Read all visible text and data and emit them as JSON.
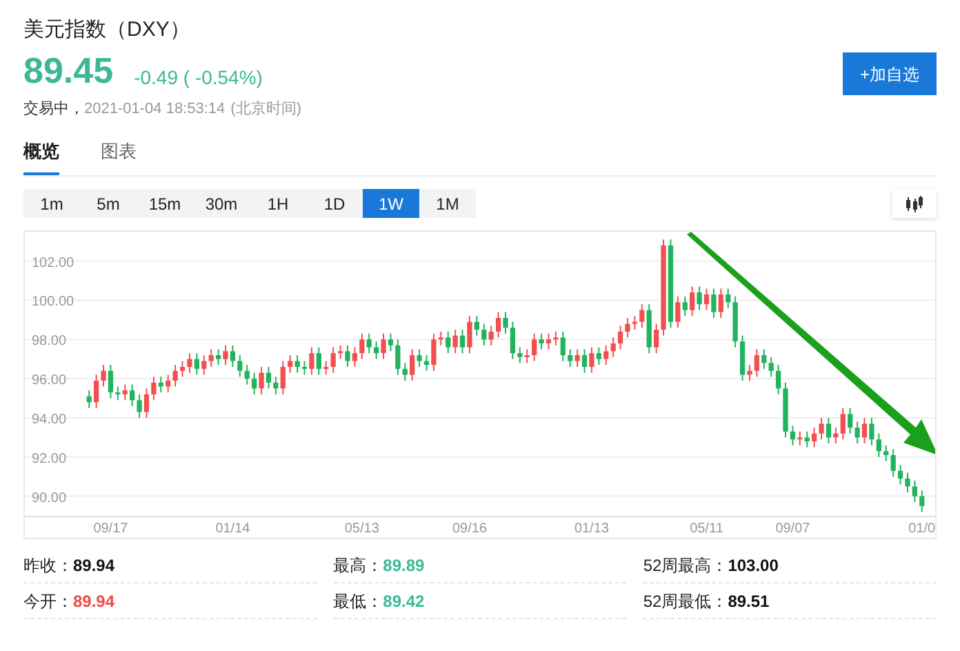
{
  "header": {
    "title": "美元指数（DXY）",
    "price": "89.45",
    "change": "-0.49 ( -0.54%)",
    "color": "#3cb896",
    "status": "交易中，",
    "time": "2021-01-04 18:53:14",
    "timezone": "(北京时间)",
    "watch_button": "+加自选"
  },
  "tabs": [
    {
      "label": "概览",
      "selected": true
    },
    {
      "label": "图表",
      "selected": false
    }
  ],
  "periods": [
    {
      "label": "1m",
      "selected": false
    },
    {
      "label": "5m",
      "selected": false
    },
    {
      "label": "15m",
      "selected": false
    },
    {
      "label": "30m",
      "selected": false
    },
    {
      "label": "1H",
      "selected": false
    },
    {
      "label": "1D",
      "selected": false
    },
    {
      "label": "1W",
      "selected": true
    },
    {
      "label": "1M",
      "selected": false
    }
  ],
  "chart": {
    "chart_data": {
      "type": "candlestick",
      "grid": true,
      "ylim": [
        89,
        103.5
      ],
      "yticks": [
        {
          "value": 90,
          "label": "90.00"
        },
        {
          "value": 92,
          "label": "92.00"
        },
        {
          "value": 94,
          "label": "94.00"
        },
        {
          "value": 96,
          "label": "96.00"
        },
        {
          "value": 98,
          "label": "98.00"
        },
        {
          "value": 100,
          "label": "100.00"
        },
        {
          "value": 102,
          "label": "102.00"
        }
      ],
      "categories": [
        null,
        null,
        null,
        "09/17",
        null,
        null,
        null,
        null,
        null,
        null,
        null,
        null,
        null,
        null,
        null,
        null,
        null,
        null,
        null,
        null,
        "01/14",
        null,
        null,
        null,
        null,
        null,
        null,
        null,
        null,
        null,
        null,
        null,
        null,
        null,
        null,
        null,
        null,
        null,
        "05/13",
        null,
        null,
        null,
        null,
        null,
        null,
        null,
        null,
        null,
        null,
        null,
        null,
        null,
        null,
        "09/16",
        null,
        null,
        null,
        null,
        null,
        null,
        null,
        null,
        null,
        null,
        null,
        null,
        null,
        null,
        null,
        null,
        "01/13",
        null,
        null,
        null,
        null,
        null,
        null,
        null,
        null,
        null,
        null,
        null,
        null,
        null,
        null,
        null,
        "05/11",
        null,
        null,
        null,
        null,
        null,
        null,
        null,
        null,
        null,
        null,
        null,
        "09/07",
        null,
        null,
        null,
        null,
        null,
        null,
        null,
        null,
        null,
        null,
        null,
        null,
        null,
        null,
        null,
        null,
        null,
        "01/0"
      ],
      "ohlc": [
        [
          95.1,
          95.4,
          94.5,
          94.8
        ],
        [
          94.8,
          96.2,
          94.5,
          95.9
        ],
        [
          95.9,
          96.7,
          95.6,
          96.4
        ],
        [
          96.4,
          96.7,
          95.0,
          95.3
        ],
        [
          95.3,
          95.6,
          94.9,
          95.2
        ],
        [
          95.2,
          95.7,
          94.9,
          95.4
        ],
        [
          95.4,
          95.7,
          94.6,
          94.9
        ],
        [
          94.9,
          95.2,
          94.0,
          94.3
        ],
        [
          94.3,
          95.5,
          94.0,
          95.2
        ],
        [
          95.2,
          96.1,
          94.9,
          95.8
        ],
        [
          95.8,
          96.1,
          95.3,
          95.6
        ],
        [
          95.6,
          96.2,
          95.3,
          95.9
        ],
        [
          95.9,
          96.7,
          95.6,
          96.4
        ],
        [
          96.4,
          96.9,
          96.1,
          96.6
        ],
        [
          96.6,
          97.3,
          96.3,
          97.0
        ],
        [
          97.0,
          97.3,
          96.2,
          96.5
        ],
        [
          96.5,
          97.2,
          96.2,
          96.9
        ],
        [
          96.9,
          97.5,
          96.6,
          97.2
        ],
        [
          97.2,
          97.5,
          96.7,
          97.0
        ],
        [
          97.0,
          97.7,
          96.7,
          97.4
        ],
        [
          97.4,
          97.7,
          96.6,
          96.9
        ],
        [
          96.9,
          97.2,
          96.1,
          96.4
        ],
        [
          96.4,
          96.7,
          95.7,
          96.0
        ],
        [
          96.0,
          96.3,
          95.2,
          95.5
        ],
        [
          95.5,
          96.6,
          95.2,
          96.3
        ],
        [
          96.3,
          96.6,
          95.5,
          95.8
        ],
        [
          95.8,
          96.1,
          95.2,
          95.5
        ],
        [
          95.5,
          96.9,
          95.2,
          96.6
        ],
        [
          96.6,
          97.2,
          96.3,
          96.9
        ],
        [
          96.9,
          97.2,
          96.3,
          96.6
        ],
        [
          96.6,
          96.9,
          96.2,
          96.5
        ],
        [
          96.5,
          97.6,
          96.2,
          97.3
        ],
        [
          97.3,
          97.6,
          96.2,
          96.5
        ],
        [
          96.5,
          96.9,
          96.2,
          96.6
        ],
        [
          96.6,
          97.6,
          96.3,
          97.3
        ],
        [
          97.3,
          97.7,
          97.0,
          97.4
        ],
        [
          97.4,
          97.7,
          96.6,
          96.9
        ],
        [
          96.9,
          97.6,
          96.6,
          97.3
        ],
        [
          97.3,
          98.3,
          97.0,
          98.0
        ],
        [
          98.0,
          98.3,
          97.3,
          97.6
        ],
        [
          97.6,
          97.9,
          97.0,
          97.3
        ],
        [
          97.3,
          98.3,
          97.0,
          98.0
        ],
        [
          98.0,
          98.3,
          97.4,
          97.7
        ],
        [
          97.7,
          98.0,
          96.2,
          96.5
        ],
        [
          96.5,
          96.8,
          95.9,
          96.2
        ],
        [
          96.2,
          97.5,
          95.9,
          97.2
        ],
        [
          97.2,
          97.5,
          96.6,
          96.9
        ],
        [
          96.9,
          97.2,
          96.4,
          96.7
        ],
        [
          96.7,
          98.3,
          96.4,
          98.0
        ],
        [
          98.0,
          98.4,
          97.7,
          98.1
        ],
        [
          98.1,
          98.4,
          97.3,
          97.6
        ],
        [
          97.6,
          98.5,
          97.3,
          98.2
        ],
        [
          98.2,
          98.5,
          97.3,
          97.6
        ],
        [
          97.6,
          99.2,
          97.3,
          98.9
        ],
        [
          98.9,
          99.2,
          98.2,
          98.5
        ],
        [
          98.5,
          98.8,
          97.7,
          98.0
        ],
        [
          98.0,
          98.7,
          97.7,
          98.4
        ],
        [
          98.4,
          99.4,
          98.1,
          99.1
        ],
        [
          99.1,
          99.4,
          98.3,
          98.6
        ],
        [
          98.6,
          98.9,
          97.0,
          97.3
        ],
        [
          97.3,
          97.6,
          96.8,
          97.1
        ],
        [
          97.1,
          97.5,
          96.8,
          97.2
        ],
        [
          97.2,
          98.3,
          96.9,
          98.0
        ],
        [
          98.0,
          98.3,
          97.5,
          97.8
        ],
        [
          97.8,
          98.3,
          97.5,
          98.0
        ],
        [
          98.0,
          98.4,
          97.7,
          98.1
        ],
        [
          98.1,
          98.4,
          96.9,
          97.2
        ],
        [
          97.2,
          97.5,
          96.6,
          96.9
        ],
        [
          96.9,
          97.5,
          96.6,
          97.2
        ],
        [
          97.2,
          97.5,
          96.3,
          96.6
        ],
        [
          96.6,
          97.6,
          96.3,
          97.3
        ],
        [
          97.3,
          97.6,
          96.7,
          97.0
        ],
        [
          97.0,
          97.7,
          96.7,
          97.4
        ],
        [
          97.4,
          98.1,
          97.1,
          97.8
        ],
        [
          97.8,
          98.7,
          97.5,
          98.4
        ],
        [
          98.4,
          99.1,
          98.1,
          98.8
        ],
        [
          98.8,
          99.2,
          98.5,
          98.9
        ],
        [
          98.9,
          99.8,
          98.6,
          99.5
        ],
        [
          99.5,
          99.8,
          97.3,
          97.6
        ],
        [
          97.6,
          98.8,
          97.3,
          98.5
        ],
        [
          98.5,
          103.1,
          98.2,
          102.8
        ],
        [
          102.8,
          103.1,
          98.6,
          98.9
        ],
        [
          98.9,
          100.2,
          98.6,
          99.9
        ],
        [
          99.9,
          100.2,
          99.2,
          99.5
        ],
        [
          99.5,
          100.7,
          99.2,
          100.4
        ],
        [
          100.4,
          100.7,
          99.5,
          99.8
        ],
        [
          99.8,
          100.6,
          99.5,
          100.3
        ],
        [
          100.3,
          100.6,
          99.1,
          99.4
        ],
        [
          99.4,
          100.6,
          99.1,
          100.3
        ],
        [
          100.3,
          100.6,
          99.6,
          99.9
        ],
        [
          99.9,
          100.2,
          97.6,
          97.9
        ],
        [
          97.9,
          98.2,
          95.9,
          96.2
        ],
        [
          96.2,
          96.7,
          95.9,
          96.4
        ],
        [
          96.4,
          97.5,
          96.1,
          97.2
        ],
        [
          97.2,
          97.5,
          96.5,
          96.8
        ],
        [
          96.8,
          97.1,
          96.1,
          96.4
        ],
        [
          96.4,
          96.7,
          95.2,
          95.5
        ],
        [
          95.5,
          95.8,
          93.0,
          93.3
        ],
        [
          93.3,
          93.6,
          92.6,
          92.9
        ],
        [
          92.9,
          93.3,
          92.6,
          93.0
        ],
        [
          93.0,
          93.3,
          92.5,
          92.8
        ],
        [
          92.8,
          93.5,
          92.5,
          93.2
        ],
        [
          93.2,
          94.0,
          92.9,
          93.7
        ],
        [
          93.7,
          94.0,
          92.7,
          93.0
        ],
        [
          93.0,
          93.5,
          92.7,
          93.2
        ],
        [
          93.2,
          94.5,
          92.9,
          94.2
        ],
        [
          94.2,
          94.5,
          93.2,
          93.5
        ],
        [
          93.5,
          93.8,
          92.7,
          93.0
        ],
        [
          93.0,
          94.0,
          92.7,
          93.7
        ],
        [
          93.7,
          94.0,
          92.6,
          92.9
        ],
        [
          92.9,
          93.2,
          92.0,
          92.3
        ],
        [
          92.3,
          92.6,
          91.8,
          92.1
        ],
        [
          92.1,
          92.4,
          91.0,
          91.3
        ],
        [
          91.3,
          91.6,
          90.6,
          90.9
        ],
        [
          90.9,
          91.2,
          90.2,
          90.5
        ],
        [
          90.5,
          90.8,
          89.7,
          90.0
        ],
        [
          90.0,
          90.3,
          89.2,
          89.5
        ]
      ]
    }
  },
  "stats": [
    {
      "label": "昨收：",
      "value": "89.94",
      "color": "#111111"
    },
    {
      "label": "最高：",
      "value": "89.89",
      "color": "#3cb896"
    },
    {
      "label": "52周最高：",
      "value": "103.00",
      "color": "#111111"
    },
    {
      "label": "今开：",
      "value": "89.94",
      "color": "#f04848"
    },
    {
      "label": "最低：",
      "value": "89.42",
      "color": "#3cb896"
    },
    {
      "label": "52周最低：",
      "value": "89.51",
      "color": "#111111"
    }
  ]
}
